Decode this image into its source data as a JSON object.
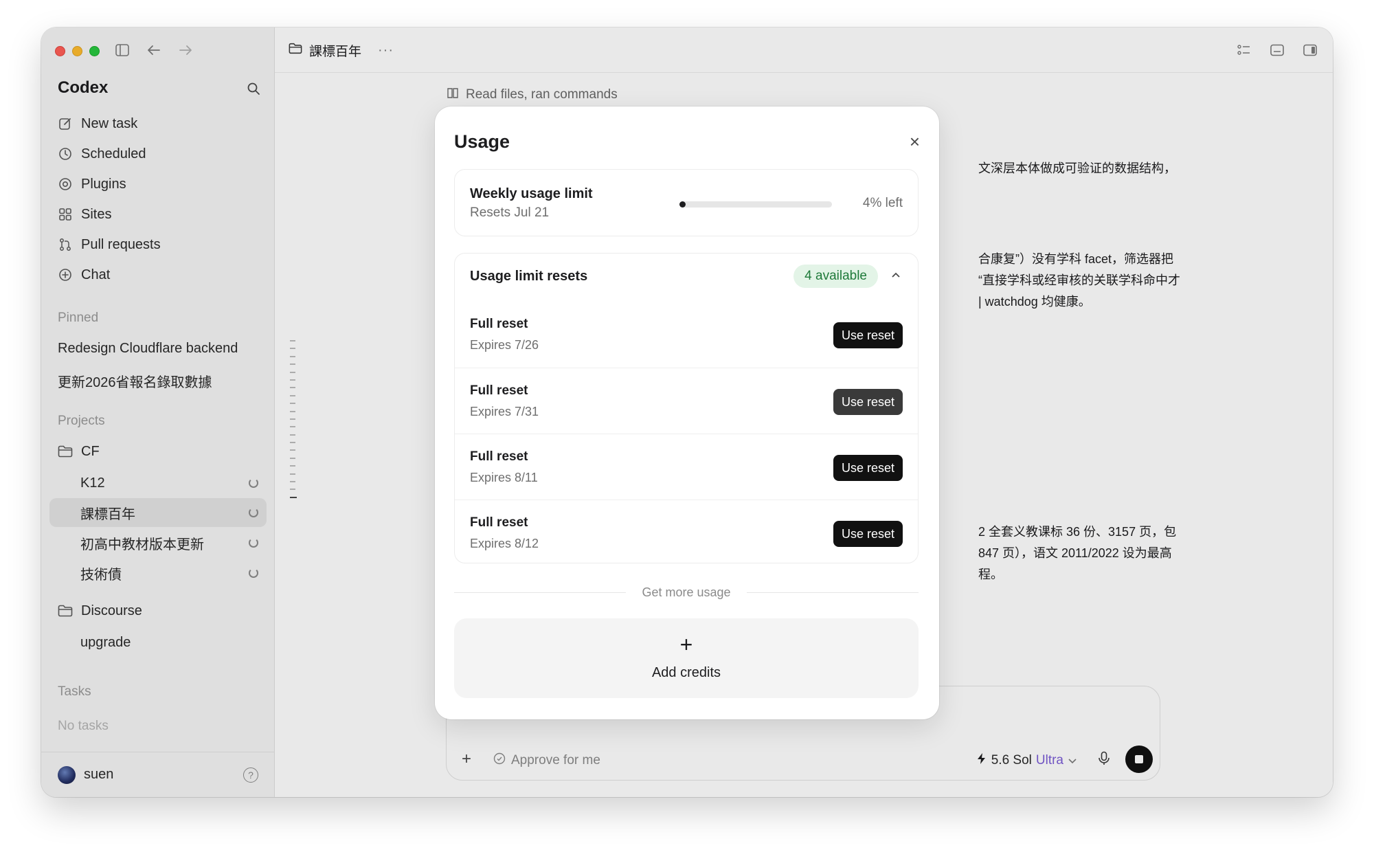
{
  "sidebar": {
    "brand": "Codex",
    "nav": [
      {
        "label": "New task",
        "icon": "edit-icon"
      },
      {
        "label": "Scheduled",
        "icon": "clock-icon"
      },
      {
        "label": "Plugins",
        "icon": "at-icon"
      },
      {
        "label": "Sites",
        "icon": "grid-icon"
      },
      {
        "label": "Pull requests",
        "icon": "pull-request-icon"
      },
      {
        "label": "Chat",
        "icon": "plus-circle-icon"
      }
    ],
    "pinned_label": "Pinned",
    "pinned": [
      "Redesign Cloudflare backend",
      "更新2026省報名錄取數據"
    ],
    "projects_label": "Projects",
    "projects": [
      {
        "name": "CF",
        "children": [
          "K12",
          "課標百年",
          "初高中教材版本更新",
          "技術債"
        ]
      },
      {
        "name": "Discourse",
        "children": [
          "upgrade"
        ]
      }
    ],
    "tasks_label": "Tasks",
    "no_tasks": "No tasks",
    "user": "suen",
    "help": "?"
  },
  "header": {
    "title": "課標百年",
    "more": "···"
  },
  "main": {
    "activity": "Read files, ran commands",
    "visible_text": [
      "文深层本体做成可验证的数据结构，",
      "合康复”）没有学科 facet，筛选器把",
      "“直接学科或经审核的关联学科命中才",
      "| watchdog 均健康。",
      "2 全套义教课标 36 份、3157 页，包",
      "847 页），语文 2011/2022 设为最高",
      "程。"
    ]
  },
  "composer": {
    "plus": "+",
    "approve": "Approve for me",
    "model": "5.6 Sol",
    "tier": "Ultra"
  },
  "modal": {
    "title": "Usage",
    "close": "×",
    "weekly": {
      "title": "Weekly usage limit",
      "resets": "Resets Jul 21",
      "left": "4% left",
      "used_fraction": 0.04
    },
    "resets": {
      "title": "Usage limit resets",
      "badge": "4 available",
      "items": [
        {
          "title": "Full reset",
          "expires": "Expires 7/26",
          "button": "Use reset"
        },
        {
          "title": "Full reset",
          "expires": "Expires 7/31",
          "button": "Use reset"
        },
        {
          "title": "Full reset",
          "expires": "Expires 8/11",
          "button": "Use reset"
        },
        {
          "title": "Full reset",
          "expires": "Expires 8/12",
          "button": "Use reset"
        }
      ]
    },
    "get_more": "Get more usage",
    "credits": {
      "plus": "+",
      "label": "Add credits"
    }
  },
  "colors": {
    "accent": "#111111",
    "badge_bg": "#e3f4e7",
    "badge_text": "#1f7a3a",
    "tier": "#7b5cd6"
  }
}
